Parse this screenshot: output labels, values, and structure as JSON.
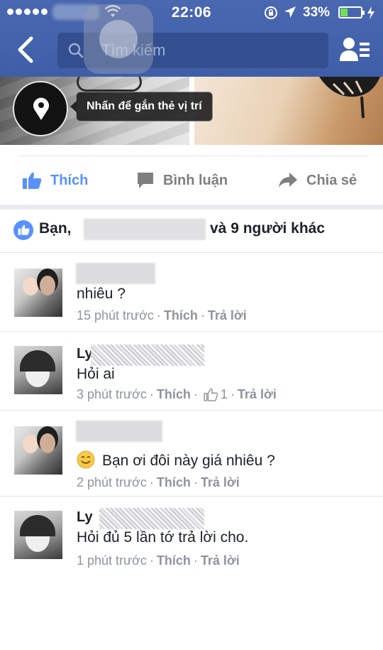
{
  "status_bar": {
    "time": "22:06",
    "battery_percent": "33%",
    "battery_level": 0.33
  },
  "search": {
    "placeholder": "Tìm kiếm"
  },
  "photo": {
    "tag_location_tooltip": "Nhấn để gắn thẻ vị trí"
  },
  "actions": {
    "like": "Thích",
    "comment": "Bình luận",
    "share": "Chia sẻ"
  },
  "likes_summary": {
    "you": "Bạn,",
    "others": "và 9 người khác"
  },
  "comments": [
    {
      "name": "",
      "text": "nhiêu ?",
      "time": "15 phút trước",
      "like": "Thích",
      "reply": "Trả lời"
    },
    {
      "name": "Ly",
      "text": "Hỏi ai",
      "time": "3 phút trước",
      "like": "Thích",
      "like_count": "1",
      "reply": "Trả lời"
    },
    {
      "name": "",
      "text": "Bạn ơi đôi này giá nhiêu ?",
      "time": "2 phút trước",
      "like": "Thích",
      "reply": "Trả lời"
    },
    {
      "name": "Ly",
      "text": "Hỏi đủ 5 lần tớ trả lời cho.",
      "time": "1 phút trước",
      "like": "Thích",
      "reply": "Trả lời"
    }
  ],
  "colors": {
    "header": "#3f5ea8",
    "accent": "#5890ff",
    "meta_text": "#8d949e"
  }
}
